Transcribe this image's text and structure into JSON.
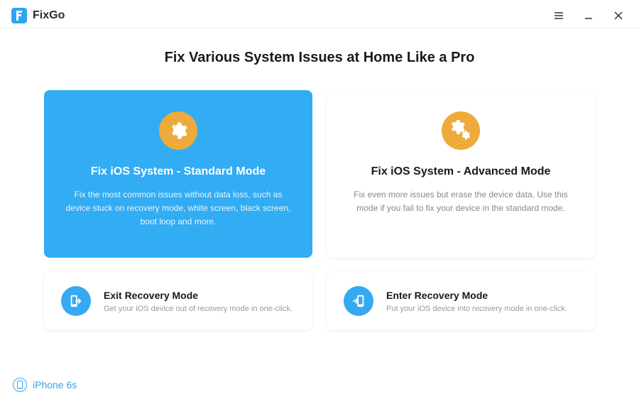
{
  "app": {
    "name": "FixGo"
  },
  "page": {
    "title": "Fix Various System Issues at Home Like a Pro"
  },
  "modes": {
    "standard": {
      "title": "Fix iOS System - Standard Mode",
      "description": "Fix the most common issues without data loss, such as device stuck on recovery mode, white screen, black screen, boot loop and more."
    },
    "advanced": {
      "title": "Fix iOS System - Advanced Mode",
      "description": "Fix even more issues but erase the device data. Use this mode if you fail to fix your device in the standard mode."
    }
  },
  "recovery": {
    "exit": {
      "title": "Exit Recovery Mode",
      "description": "Get your iOS device out of recovery mode in one-click."
    },
    "enter": {
      "title": "Enter Recovery Mode",
      "description": "Put your iOS device into recovery mode in one-click."
    }
  },
  "device": {
    "name": "iPhone 6s"
  }
}
